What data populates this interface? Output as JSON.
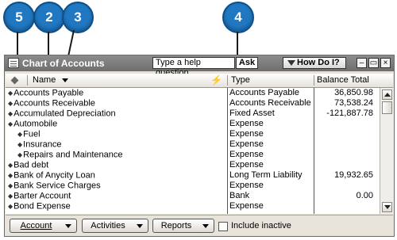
{
  "callouts": [
    "5",
    "2",
    "3",
    "4"
  ],
  "window": {
    "title": "Chart of Accounts",
    "help_text": "Type a help question",
    "ask_label": "Ask",
    "howdoi_label": "How Do I?"
  },
  "columns": {
    "name": "Name",
    "bolt": "⚡",
    "type": "Type",
    "balance": "Balance Total"
  },
  "accounts": [
    {
      "name": "Accounts Payable",
      "type": "Accounts Payable",
      "balance": "36,850.98",
      "indent": false
    },
    {
      "name": "Accounts Receivable",
      "type": "Accounts Receivable",
      "balance": "73,538.24",
      "indent": false
    },
    {
      "name": "Accumulated Depreciation",
      "type": "Fixed Asset",
      "balance": "-121,887.78",
      "indent": false
    },
    {
      "name": "Automobile",
      "type": "Expense",
      "balance": "",
      "indent": false
    },
    {
      "name": "Fuel",
      "type": "Expense",
      "balance": "",
      "indent": true
    },
    {
      "name": "Insurance",
      "type": "Expense",
      "balance": "",
      "indent": true
    },
    {
      "name": "Repairs and Maintenance",
      "type": "Expense",
      "balance": "",
      "indent": true
    },
    {
      "name": "Bad debt",
      "type": "Expense",
      "balance": "",
      "indent": false
    },
    {
      "name": "Bank of Anycity Loan",
      "type": "Long Term Liability",
      "balance": "19,932.65",
      "indent": false
    },
    {
      "name": "Bank Service Charges",
      "type": "Expense",
      "balance": "",
      "indent": false
    },
    {
      "name": "Barter Account",
      "type": "Bank",
      "balance": "0.00",
      "indent": false
    },
    {
      "name": "Bond Expense",
      "type": "Expense",
      "balance": "",
      "indent": false
    }
  ],
  "buttons": {
    "account": "Account",
    "activities": "Activities",
    "reports": "Reports",
    "include_inactive": "Include inactive"
  },
  "colors": {
    "callout": "#1f78c1",
    "titlebar": "#7a7a7a"
  }
}
